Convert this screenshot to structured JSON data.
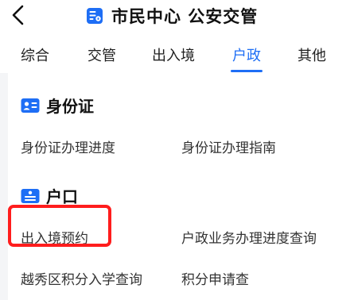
{
  "header": {
    "title": "市民中心 公安交管",
    "back_icon": "chevron-left-icon",
    "title_icon": "id-document-icon",
    "accent": "#1e6ef5"
  },
  "tabs": [
    {
      "label": "综合",
      "active": false
    },
    {
      "label": "交管",
      "active": false
    },
    {
      "label": "出入境",
      "active": false
    },
    {
      "label": "户政",
      "active": true
    },
    {
      "label": "其他",
      "active": false
    }
  ],
  "sections": [
    {
      "title": "身份证",
      "icon": "id-card-icon",
      "links": [
        "身份证办理进度",
        "身份证办理指南"
      ]
    },
    {
      "title": "户口",
      "icon": "household-register-icon",
      "links": [
        "出入境预约",
        "户政业务办理进度查询",
        "越秀区积分入学查询",
        "积分申请查"
      ]
    }
  ],
  "highlight_color": "#ff1d1d"
}
